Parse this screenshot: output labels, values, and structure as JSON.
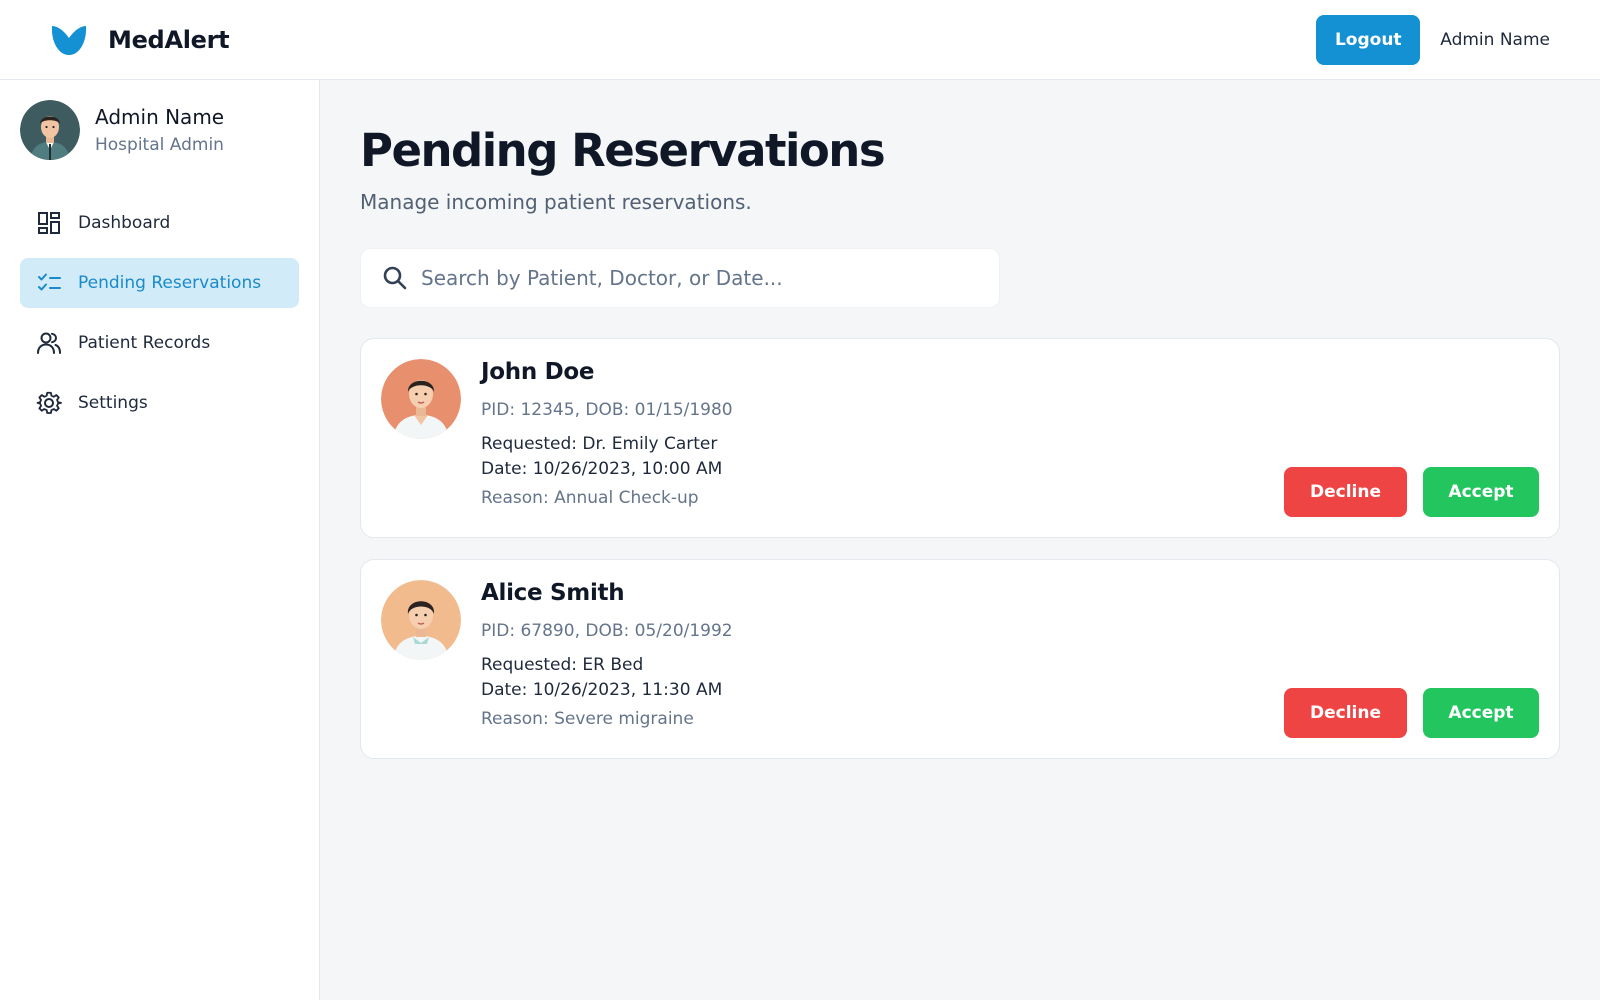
{
  "header": {
    "brand": "MedAlert",
    "logout_label": "Logout",
    "user_name": "Admin Name",
    "colors": {
      "primary": "#1391d3"
    }
  },
  "sidebar": {
    "profile": {
      "name": "Admin Name",
      "role": "Hospital Admin"
    },
    "items": [
      {
        "label": "Dashboard",
        "icon": "dashboard-icon",
        "active": false
      },
      {
        "label": "Pending Reservations",
        "icon": "checklist-icon",
        "active": true
      },
      {
        "label": "Patient Records",
        "icon": "users-icon",
        "active": false
      },
      {
        "label": "Settings",
        "icon": "gear-icon",
        "active": false
      }
    ],
    "colors": {
      "active_bg": "#d2ebf8",
      "active_text": "#1a8acb"
    }
  },
  "main": {
    "title": "Pending Reservations",
    "subtitle": "Manage incoming patient reservations.",
    "search": {
      "placeholder": "Search by Patient, Doctor, or Date..."
    },
    "reservations": [
      {
        "name": "John Doe",
        "ids": "PID: 12345, DOB: 01/15/1980",
        "requested": "Requested: Dr. Emily Carter",
        "date": "Date: 10/26/2023, 10:00 AM",
        "reason": "Reason: Annual Check-up",
        "decline_label": "Decline",
        "accept_label": "Accept"
      },
      {
        "name": "Alice Smith",
        "ids": "PID: 67890, DOB: 05/20/1992",
        "requested": "Requested: ER Bed",
        "date": "Date: 10/26/2023, 11:30 AM",
        "reason": "Reason: Severe migraine",
        "decline_label": "Decline",
        "accept_label": "Accept"
      }
    ],
    "colors": {
      "decline": "#ef4444",
      "accept": "#22c55e"
    }
  }
}
